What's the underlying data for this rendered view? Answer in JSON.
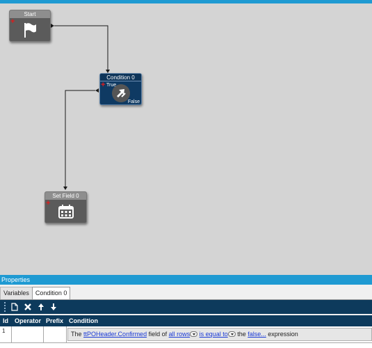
{
  "workflow": {
    "nodes": {
      "start": {
        "title": "Start",
        "icon": "flag-icon"
      },
      "condition": {
        "title": "Condition 0",
        "icon": "condition-icon",
        "true_label": "True",
        "false_label": "False"
      },
      "setfield": {
        "title": "Set Field 0",
        "icon": "calendar-icon"
      }
    }
  },
  "properties": {
    "title": "Properties",
    "tabs": [
      {
        "label": "Variables"
      },
      {
        "label": "Condition 0"
      }
    ],
    "toolbar": {
      "new_icon": "new-document-icon",
      "delete_icon": "delete-icon",
      "up_icon": "arrow-up-icon",
      "down_icon": "arrow-down-icon"
    },
    "columns": [
      "Id",
      "Operator",
      "Prefix",
      "Condition"
    ],
    "rows": [
      {
        "id": "1",
        "condition": {
          "t1": "The",
          "field": "ttPOHeader.Confirmed",
          "t2": "field of",
          "scope": "all rows",
          "op": "is equal to",
          "t3": "the",
          "value": "false...",
          "t4": "expression"
        }
      }
    ]
  },
  "colors": {
    "accent": "#1f9ad2",
    "dark_blue": "#0d3a5c",
    "node_grey": "#5b5b5b"
  }
}
